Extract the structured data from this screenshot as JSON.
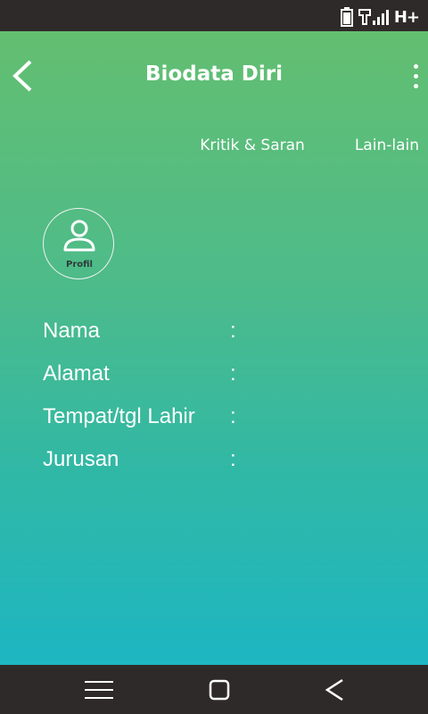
{
  "app": {
    "title": "Biodata Diri"
  },
  "status_bar": {
    "network": "H+",
    "icons": [
      "battery-icon",
      "signal-icon"
    ]
  },
  "tabs": [
    {
      "label": "Kritik & Saran"
    },
    {
      "label": "Lain-lain"
    }
  ],
  "profile": {
    "label": "Profil",
    "icon": "user-icon"
  },
  "fields": [
    {
      "label": "Nama",
      "separator": ":",
      "value": ""
    },
    {
      "label": "Alamat",
      "separator": ":",
      "value": ""
    },
    {
      "label": "Tempat/tgl Lahir",
      "separator": ":",
      "value": ""
    },
    {
      "label": "Jurusan",
      "separator": ":",
      "value": ""
    }
  ],
  "nav_bar": {
    "icons": [
      "menu-icon",
      "home-icon",
      "back-icon"
    ]
  },
  "colors": {
    "gradient_top": "#63bf70",
    "gradient_bottom": "#1db6c2",
    "system_bar": "#2f2a2a"
  }
}
